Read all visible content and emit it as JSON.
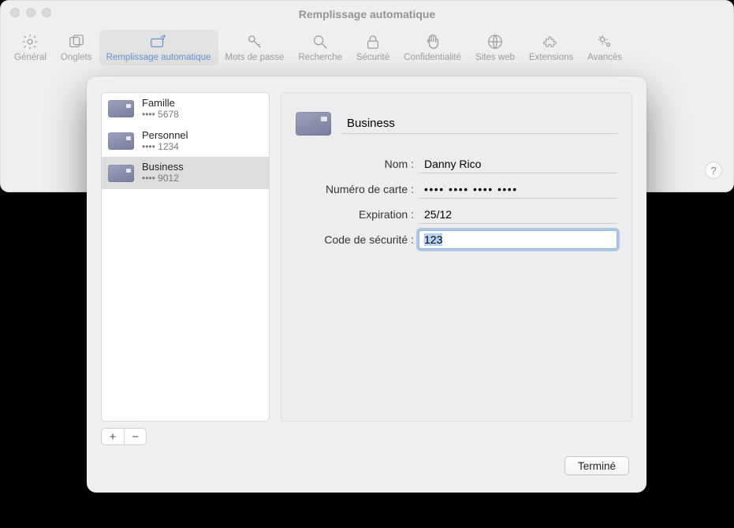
{
  "window": {
    "title": "Remplissage automatique"
  },
  "toolbar": {
    "items": [
      {
        "label": "Général",
        "icon": "gear"
      },
      {
        "label": "Onglets",
        "icon": "tabs"
      },
      {
        "label": "Remplissage automatique",
        "icon": "autofill",
        "active": true
      },
      {
        "label": "Mots de passe",
        "icon": "key"
      },
      {
        "label": "Recherche",
        "icon": "search"
      },
      {
        "label": "Sécurité",
        "icon": "lock"
      },
      {
        "label": "Confidentialité",
        "icon": "hand"
      },
      {
        "label": "Sites web",
        "icon": "globe"
      },
      {
        "label": "Extensions",
        "icon": "puzzle"
      },
      {
        "label": "Avancés",
        "icon": "gears"
      }
    ]
  },
  "help_label": "?",
  "cards": [
    {
      "name": "Famille",
      "last4": "5678",
      "selected": false
    },
    {
      "name": "Personnel",
      "last4": "1234",
      "selected": false
    },
    {
      "name": "Business",
      "last4": "9012",
      "selected": true
    }
  ],
  "masked_prefix": "•••• ",
  "detail": {
    "description_value": "Business",
    "rows": {
      "name": {
        "label": "Nom :",
        "value": "Danny Rico"
      },
      "number": {
        "label": "Numéro de carte :",
        "value": "•••• •••• •••• ••••"
      },
      "expiry": {
        "label": "Expiration :",
        "value": "25/12"
      },
      "cvc": {
        "label": "Code de sécurité :",
        "value": "123",
        "focused": true
      }
    }
  },
  "buttons": {
    "add": "+",
    "remove": "−",
    "done": "Terminé"
  }
}
